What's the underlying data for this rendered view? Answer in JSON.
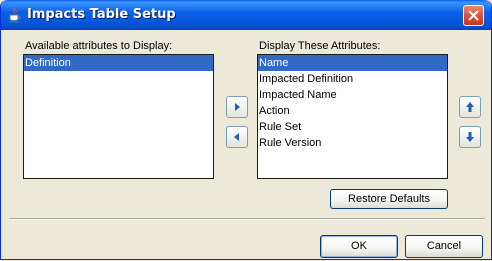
{
  "window": {
    "title": "Impacts Table Setup"
  },
  "available": {
    "label": "Available attributes to Display:",
    "items": [
      "Definition"
    ],
    "selected": "Definition"
  },
  "display": {
    "label": "Display These Attributes:",
    "items": [
      "Name",
      "Impacted Definition",
      "Impacted Name",
      "Action",
      "Rule Set",
      "Rule Version"
    ],
    "selected": "Name"
  },
  "buttons": {
    "restore_defaults": "Restore Defaults",
    "ok": "OK",
    "cancel": "Cancel"
  },
  "icons": {
    "app": "java-cup-icon",
    "add": "arrow-right-icon",
    "remove": "arrow-left-icon",
    "move_up": "arrow-up-icon",
    "move_down": "arrow-down-icon",
    "close": "close-icon"
  },
  "colors": {
    "title_bar": "#0a5ee8",
    "selection": "#316ac5",
    "arrow_blue": "#1f5fb4",
    "close_red": "#d8553b"
  }
}
